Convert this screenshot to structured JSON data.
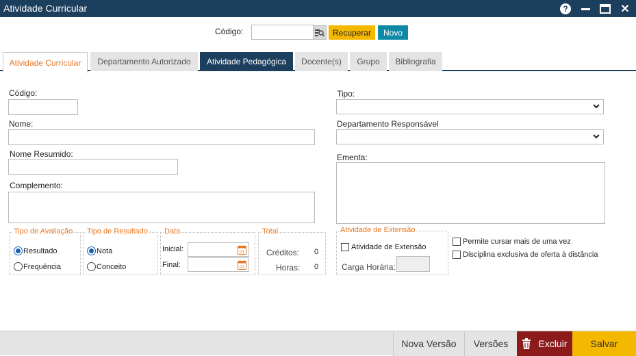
{
  "window": {
    "title": "Atividade Curricular",
    "help_glyph": "?",
    "close_glyph": "✕"
  },
  "search": {
    "label": "Código:",
    "value": "",
    "recuperar_label": "Recuperar",
    "novo_label": "Novo"
  },
  "tabs": [
    {
      "label": "Atividade Curricular"
    },
    {
      "label": "Departamento Autorizado"
    },
    {
      "label": "Atividade Pedagógica"
    },
    {
      "label": "Docente(s)"
    },
    {
      "label": "Grupo"
    },
    {
      "label": "Bibliografia"
    }
  ],
  "form": {
    "codigo_label": "Código:",
    "codigo_value": "",
    "nome_label": "Nome:",
    "nome_value": "",
    "nome_resumido_label": "Nome Resumido:",
    "nome_resumido_value": "",
    "complemento_label": "Complemento:",
    "tipo_label": "Tipo:",
    "tipo_value": "",
    "departamento_label": "Departamento Responsável",
    "departamento_value": "",
    "ementa_label": "Ementa:"
  },
  "avaliacao": {
    "legend": "Tipo de Avaliação",
    "options": [
      "Resultado",
      "Frequência"
    ],
    "selected": "Resultado"
  },
  "resultado": {
    "legend": "Tipo de Resultado",
    "options": [
      "Nota",
      "Conceito"
    ],
    "selected": "Nota"
  },
  "data": {
    "legend": "Data",
    "inicial_label": "Inicial:",
    "final_label": "Final:",
    "inicial_value": "",
    "final_value": "",
    "calendar_glyph": "01"
  },
  "total": {
    "legend": "Total",
    "creditos_label": "Créditos:",
    "creditos_value": "0",
    "horas_label": "Horas:",
    "horas_value": "0"
  },
  "extensao": {
    "legend": "Atividade de Extensão",
    "checkbox_label": "Atividade de Extensão",
    "carga_label": "Carga Horária:",
    "carga_value": ""
  },
  "options": {
    "permite_label": "Permite cursar mais de uma vez",
    "distancia_label": "Disciplina exclusiva de oferta à distância"
  },
  "footer": {
    "nova_versao": "Nova Versão",
    "versoes": "Versões",
    "excluir": "Excluir",
    "salvar": "Salvar"
  },
  "colors": {
    "titlebar": "#1d3f5e",
    "accent_orange": "#e87722",
    "recuperar_yellow": "#f5b800",
    "novo_teal": "#0e8aa6",
    "excluir_red": "#8c1c1c"
  },
  "icons": [
    "help-icon",
    "minimize-icon",
    "maximize-icon",
    "close-icon",
    "search-icon",
    "calendar-icon",
    "chevron-down-icon",
    "trash-icon"
  ]
}
